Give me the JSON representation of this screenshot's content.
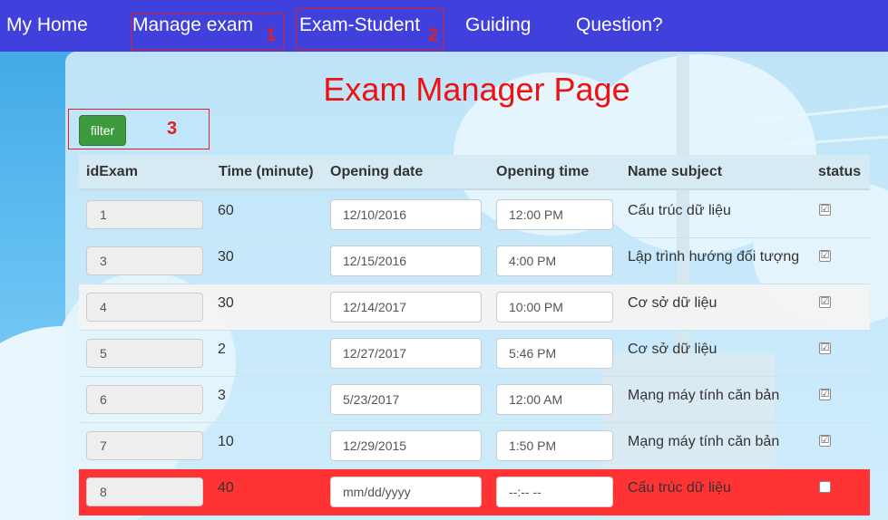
{
  "nav": {
    "home": "My Home",
    "manage_exam": "Manage exam",
    "exam_student": "Exam-Student",
    "guiding": "Guiding",
    "question": "Question?"
  },
  "annotations": [
    "1",
    "2",
    "3"
  ],
  "page_title": "Exam Manager Page",
  "filter_label": "filter",
  "table": {
    "headers": [
      "idExam",
      "Time (minute)",
      "Opening date",
      "Opening time",
      "Name subject",
      "status"
    ],
    "rows": [
      {
        "id": "1",
        "time": "60",
        "date": "12/10/2016",
        "clock": "12:00 PM",
        "subject": "Cấu trúc dữ liệu",
        "status": "checked"
      },
      {
        "id": "3",
        "time": "30",
        "date": "12/15/2016",
        "clock": "4:00 PM",
        "subject": "Lập trình hướng đối tượng",
        "status": "checked"
      },
      {
        "id": "4",
        "time": "30",
        "date": "12/14/2017",
        "clock": "10:00 PM",
        "subject": "Cơ sở dữ liệu",
        "status": "checked"
      },
      {
        "id": "5",
        "time": "2",
        "date": "12/27/2017",
        "clock": "5:46 PM",
        "subject": "Cơ sở dữ liệu",
        "status": "checked"
      },
      {
        "id": "6",
        "time": "3",
        "date": "5/23/2017",
        "clock": "12:00 AM",
        "subject": "Mạng máy tính căn bản",
        "status": "checked"
      },
      {
        "id": "7",
        "time": "10",
        "date": "12/29/2015",
        "clock": "1:50 PM",
        "subject": "Mạng máy tính căn bản",
        "status": "checked"
      },
      {
        "id": "8",
        "time": "40",
        "date": "mm/dd/yyyy",
        "clock": "--:-- --",
        "subject": "Cấu trúc dữ liệu",
        "status": "unchecked"
      }
    ]
  },
  "colors": {
    "nav_bg": "#4040dd",
    "title": "#ee1111",
    "annotation": "#e02020",
    "filter_button": "#3e9a3e",
    "highlight_row": "#ff3333"
  },
  "icons": {
    "checked": "☑",
    "unchecked": ""
  }
}
